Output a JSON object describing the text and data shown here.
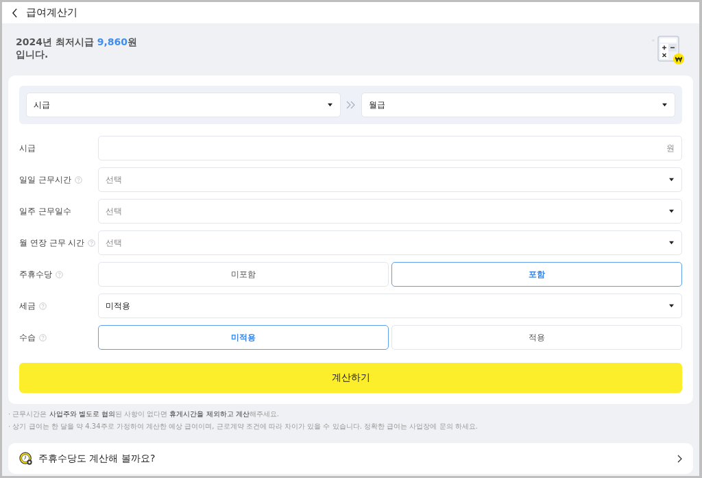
{
  "header": {
    "title": "급여계산기"
  },
  "intro": {
    "text": "2024년 최저시급 **9,860**원\n입니다."
  },
  "converter": {
    "from": "시급",
    "to": "월급"
  },
  "fields": [
    {
      "kind": "input",
      "label": "시급",
      "help": false,
      "unit": "원"
    },
    {
      "kind": "select",
      "label": "일일 근무시간",
      "help": true,
      "placeholder": "선택"
    },
    {
      "kind": "select",
      "label": "일주 근무일수",
      "help": false,
      "placeholder": "선택"
    },
    {
      "kind": "select",
      "label": "월 연장 근무 시간",
      "help": true,
      "placeholder": "선택"
    },
    {
      "kind": "toggle",
      "label": "주휴수당",
      "help": true,
      "options": [
        {
          "label": "미포함",
          "selected": false
        },
        {
          "label": "포함",
          "selected": true
        }
      ]
    },
    {
      "kind": "select",
      "label": "세금",
      "help": true,
      "value": "미적용"
    },
    {
      "kind": "toggle",
      "label": "수습",
      "help": true,
      "options": [
        {
          "label": "미적용",
          "selected": true
        },
        {
          "label": "적용",
          "selected": false
        }
      ]
    }
  ],
  "calculate_button": "계산하기",
  "notes": [
    "· 근무시간은 **사업주와 별도로 협의**된 사항이 없다면 **휴게시간을 제외하고 계산**해주세요.",
    "· 상기 급여는 한 달을 약 4.34주로 가정하여 계산한 예상 급여이며, 근로계약 조건에 따라 차이가 있을 수 있습니다. 정확한 급여는 사업장에 문의 하세요."
  ],
  "promo": {
    "text": "주휴수당도 계산해 볼까요?"
  }
}
